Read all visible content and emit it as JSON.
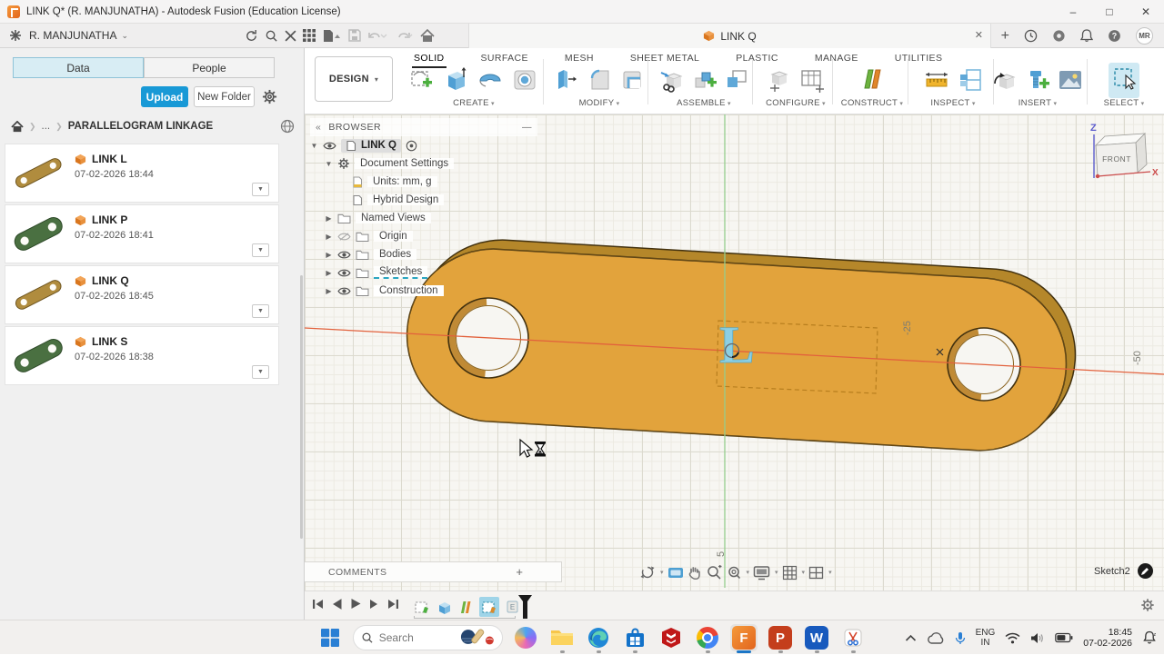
{
  "window": {
    "title": "LINK Q* (R. MANJUNATHA) - Autodesk Fusion (Education License)"
  },
  "icons": {
    "minimize": "–",
    "maximize": "□",
    "close": "✕",
    "plus": "+",
    "dash": "—",
    "chev_double": "«",
    "caret_down": "⌄",
    "ellipsis": "...",
    "help": "?"
  },
  "app_toolbar": {
    "user": "R. MANJUNATHA",
    "tab_label": "LINK Q",
    "avatar": "MR"
  },
  "ribbon": {
    "design": "DESIGN",
    "tabs": [
      "SOLID",
      "SURFACE",
      "MESH",
      "SHEET METAL",
      "PLASTIC",
      "MANAGE",
      "UTILITIES"
    ],
    "active_tab": "SOLID",
    "groups": [
      "CREATE",
      "MODIFY",
      "ASSEMBLE",
      "CONFIGURE",
      "CONSTRUCT",
      "INSPECT",
      "INSERT",
      "SELECT"
    ]
  },
  "sidebar": {
    "tab_data": "Data",
    "tab_people": "People",
    "upload": "Upload",
    "new_folder": "New Folder",
    "breadcrumb_folder": "PARALLELOGRAM LINKAGE",
    "items": [
      {
        "name": "LINK L",
        "date": "07-02-2026 18:44",
        "thumb": "#b08c3e"
      },
      {
        "name": "LINK P",
        "date": "07-02-2026 18:41",
        "thumb": "#4a7041"
      },
      {
        "name": "LINK Q",
        "date": "07-02-2026 18:45",
        "thumb": "#b08c3e"
      },
      {
        "name": "LINK S",
        "date": "07-02-2026 18:38",
        "thumb": "#4a7041"
      }
    ]
  },
  "browser": {
    "title": "BROWSER",
    "root": "LINK Q",
    "doc_settings": "Document Settings",
    "units": "Units: mm, g",
    "hybrid": "Hybrid Design",
    "named_views": "Named Views",
    "origin": "Origin",
    "bodies": "Bodies",
    "sketches": "Sketches",
    "construction": "Construction"
  },
  "viewcube": {
    "front": "FRONT",
    "axis_z": "Z",
    "axis_x": "X"
  },
  "canvas": {
    "sketch_letter": "L",
    "grid_labels": [
      "-25",
      "-50",
      "5"
    ],
    "active_sketch": "Sketch2"
  },
  "comments": {
    "label": "COMMENTS"
  },
  "taskbar": {
    "search": "Search",
    "lang_top": "ENG",
    "lang_bottom": "IN",
    "time": "18:45",
    "date": "07-02-2026"
  },
  "colors": {
    "accent_blue": "#0696d7",
    "part_orange": "#e2a33c",
    "part_side": "#a87c24",
    "axis_red": "#e2613c",
    "axis_green": "#95cd8d",
    "select_highlight": "#cfe9f3"
  }
}
